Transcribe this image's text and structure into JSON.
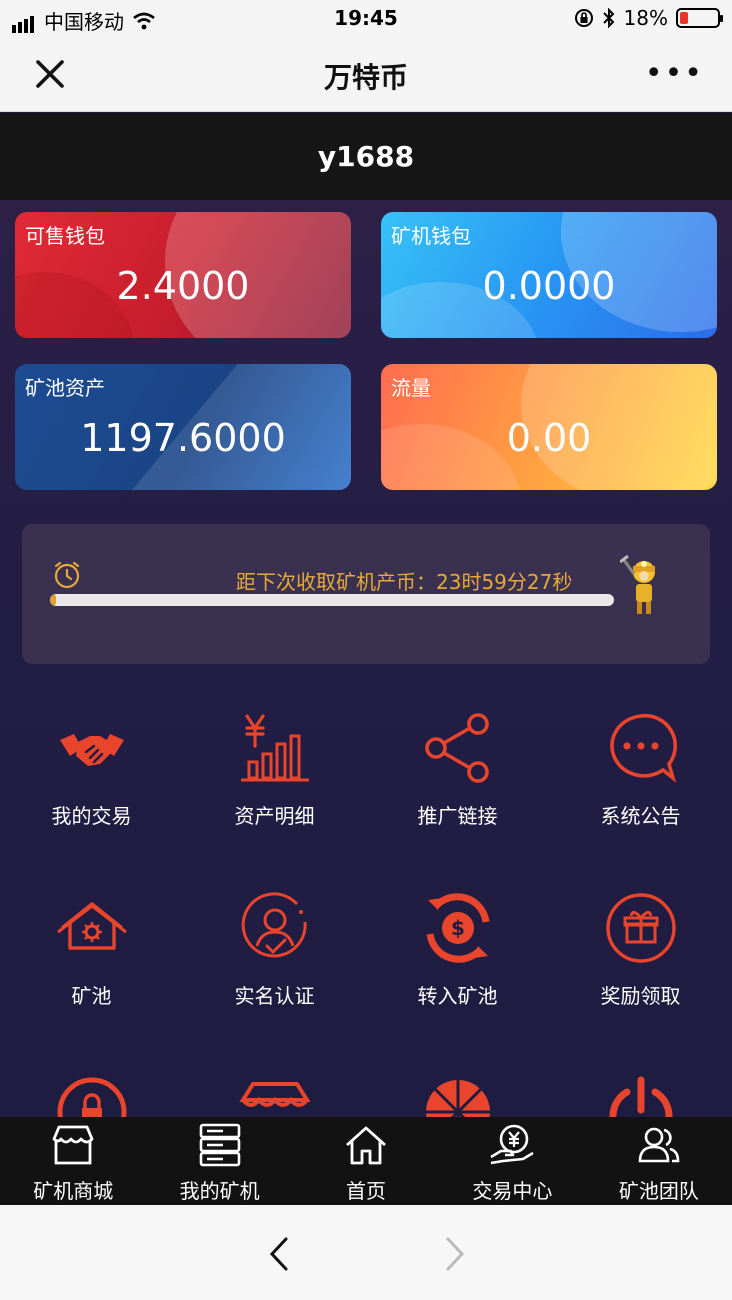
{
  "status": {
    "carrier": "中国移动",
    "time": "19:45",
    "battery": "18%"
  },
  "nav": {
    "title": "万特币",
    "more": "•••"
  },
  "user": {
    "name": "y1688"
  },
  "cards": [
    {
      "label": "可售钱包",
      "value": "2.4000"
    },
    {
      "label": "矿机钱包",
      "value": "0.0000"
    },
    {
      "label": "矿池资产",
      "value": "1197.6000"
    },
    {
      "label": "流量",
      "value": "0.00"
    }
  ],
  "timer": {
    "text": "距下次收取矿机产币：23时59分27秒",
    "progress": 0.01
  },
  "menu": [
    {
      "label": "我的交易",
      "icon": "handshake-icon"
    },
    {
      "label": "资产明细",
      "icon": "yen-chart-icon"
    },
    {
      "label": "推广链接",
      "icon": "share-icon"
    },
    {
      "label": "系统公告",
      "icon": "chat-bubble-icon"
    },
    {
      "label": "矿池",
      "icon": "house-gear-icon"
    },
    {
      "label": "实名认证",
      "icon": "user-verify-icon"
    },
    {
      "label": "转入矿池",
      "icon": "dollar-refresh-icon"
    },
    {
      "label": "奖励领取",
      "icon": "gift-icon"
    }
  ],
  "tabs": [
    {
      "label": "矿机商城",
      "icon": "shop-icon"
    },
    {
      "label": "我的矿机",
      "icon": "server-icon"
    },
    {
      "label": "首页",
      "icon": "home-icon"
    },
    {
      "label": "交易中心",
      "icon": "yen-hand-icon"
    },
    {
      "label": "矿池团队",
      "icon": "team-icon"
    }
  ],
  "colors": {
    "accent": "#e8452c",
    "gold": "#e8a93a"
  }
}
